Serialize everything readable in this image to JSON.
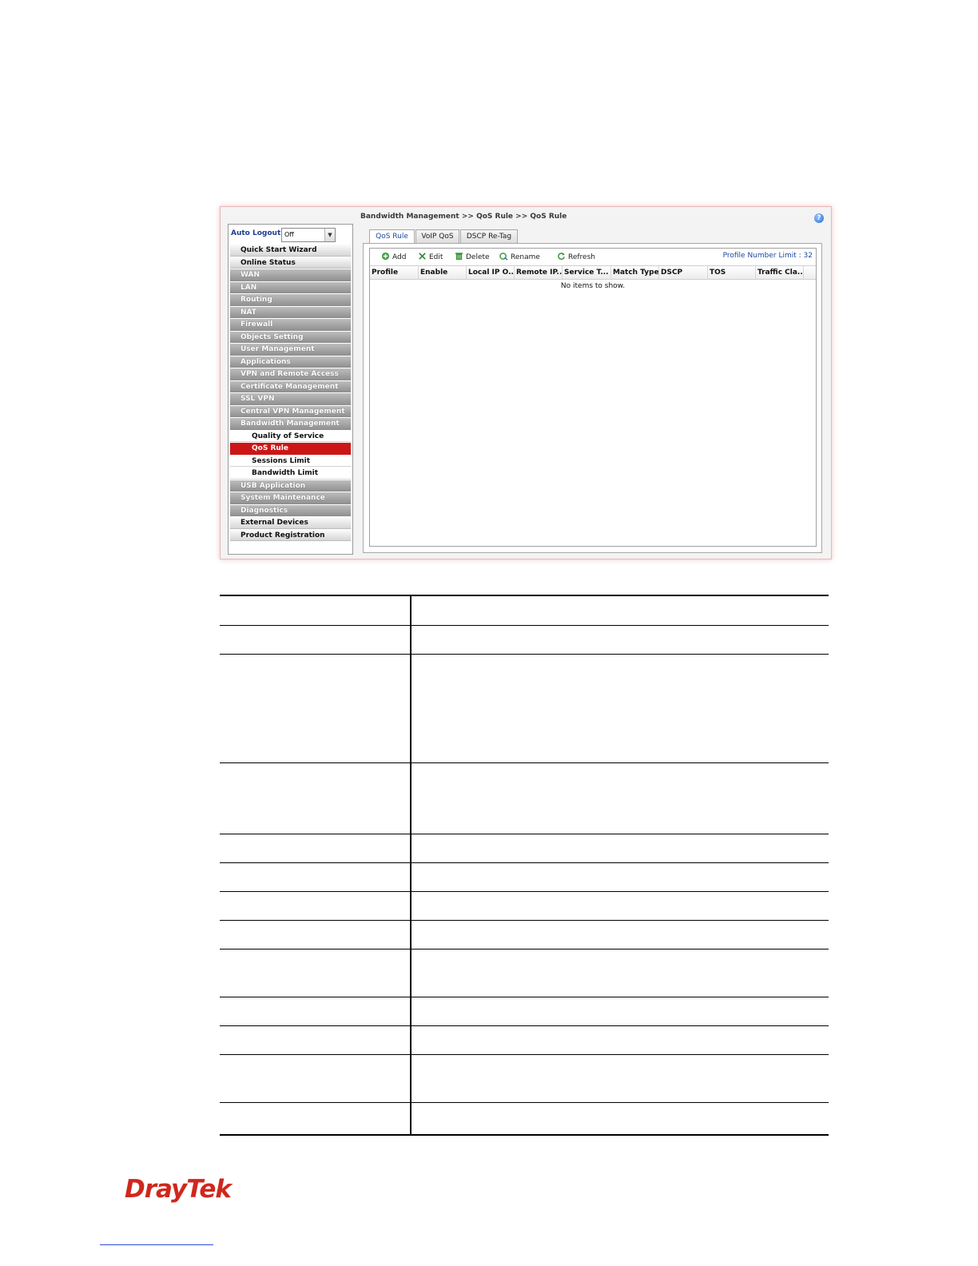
{
  "sidebar": {
    "auto_logout_label": "Auto Logout :",
    "auto_logout_value": "Off",
    "menu": [
      {
        "label": "Quick Start Wizard",
        "style": "light"
      },
      {
        "label": "Online Status",
        "style": "light"
      },
      {
        "label": "WAN",
        "style": "dark"
      },
      {
        "label": "LAN",
        "style": "dark"
      },
      {
        "label": "Routing",
        "style": "dark"
      },
      {
        "label": "NAT",
        "style": "dark"
      },
      {
        "label": "Firewall",
        "style": "dark"
      },
      {
        "label": "Objects Setting",
        "style": "dark"
      },
      {
        "label": "User Management",
        "style": "dark"
      },
      {
        "label": "Applications",
        "style": "dark"
      },
      {
        "label": "VPN and Remote Access",
        "style": "dark"
      },
      {
        "label": "Certificate Management",
        "style": "dark"
      },
      {
        "label": "SSL VPN",
        "style": "dark"
      },
      {
        "label": "Central VPN Management",
        "style": "dark"
      },
      {
        "label": "Bandwidth Management",
        "style": "dark"
      },
      {
        "label": "Quality of Service",
        "style": "sub"
      },
      {
        "label": "QoS Rule",
        "style": "active"
      },
      {
        "label": "Sessions Limit",
        "style": "sub"
      },
      {
        "label": "Bandwidth Limit",
        "style": "sub"
      },
      {
        "label": "USB Application",
        "style": "dark"
      },
      {
        "label": "System Maintenance",
        "style": "dark"
      },
      {
        "label": "Diagnostics",
        "style": "dark"
      },
      {
        "label": "External Devices",
        "style": "light"
      },
      {
        "label": "Product Registration",
        "style": "light"
      }
    ]
  },
  "main": {
    "breadcrumb": "Bandwidth Management >> QoS Rule >> QoS Rule",
    "help_icon": "?",
    "tabs": [
      "QoS Rule",
      "VoIP QoS",
      "DSCP Re-Tag"
    ],
    "toolbar": {
      "add": "Add",
      "edit": "Edit",
      "delete": "Delete",
      "rename": "Rename",
      "refresh": "Refresh",
      "profile_limit": "Profile Number Limit : 32"
    },
    "columns": [
      "Profile",
      "Enable",
      "Local IP O...",
      "Remote IP...",
      "Service T...",
      "Match Type",
      "DSCP",
      "TOS",
      "Traffic Cla..."
    ],
    "empty_message": "No items to show."
  },
  "footer": {
    "logo": "DrayTek"
  },
  "colors": {
    "active_menu": "#cc1616",
    "link_blue": "#1b4aa0",
    "logo_red": "#d0271d"
  }
}
